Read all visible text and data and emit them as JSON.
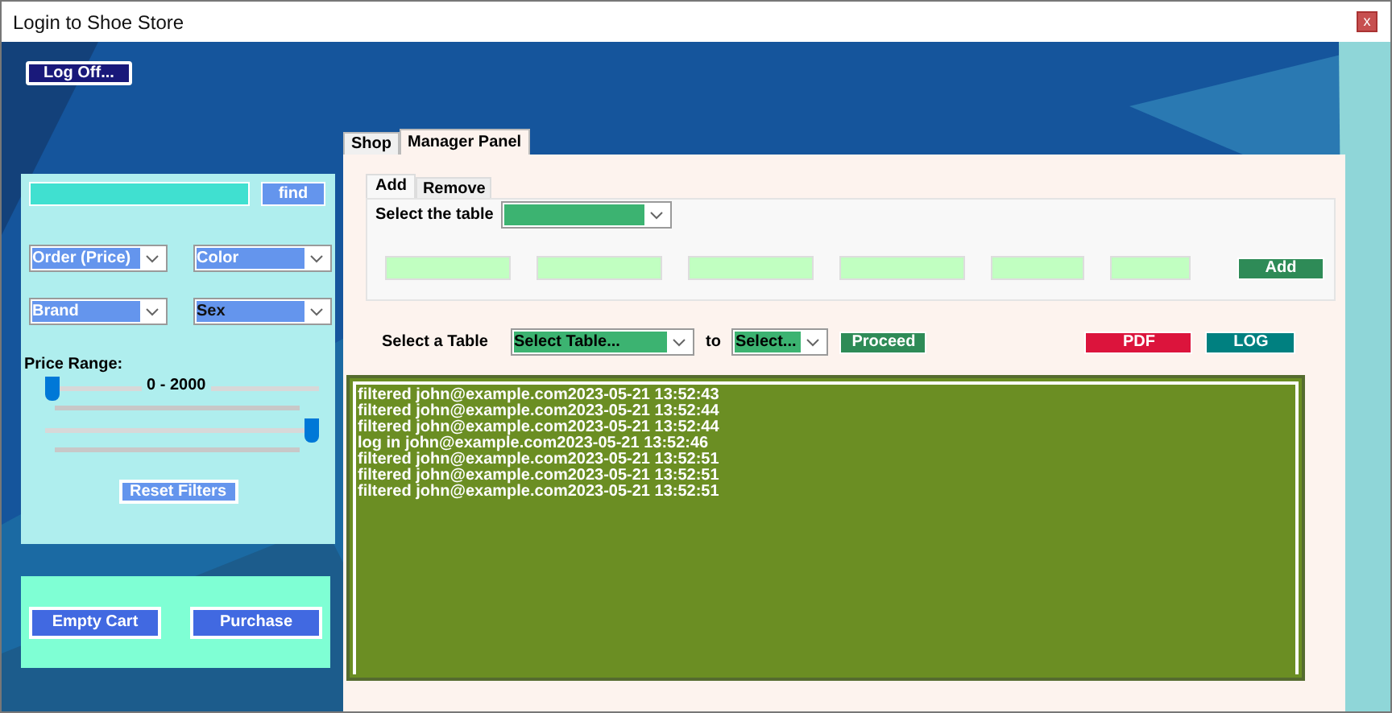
{
  "window": {
    "title": "Login to Shoe Store",
    "close": "x"
  },
  "log_off": "Log Off...",
  "filters": {
    "find": "find",
    "dropdowns": [
      {
        "value": "Order (Price)"
      },
      {
        "value": "Color"
      },
      {
        "value": "Brand"
      },
      {
        "value": "Sex"
      }
    ],
    "price_label": "Price Range:",
    "price_reading": "0 - 2000",
    "sliders": [
      {
        "level": 0
      },
      {
        "level": 1
      }
    ],
    "reset": "Reset Filters"
  },
  "cart": {
    "buttons": [
      "Empty Cart",
      "Purchase"
    ]
  },
  "tabs": [
    {
      "label": "Shop",
      "selected": false
    },
    {
      "label": "Manager Panel",
      "selected": true
    }
  ],
  "subtabs": [
    {
      "label": "Add",
      "selected": true
    },
    {
      "label": "Remove",
      "selected": false
    }
  ],
  "add_panel": {
    "label": "Select the table",
    "button": "Add"
  },
  "transfer": {
    "label": "Select a Table",
    "from": "Select Table...",
    "to_label": "to",
    "to": "Select...",
    "proceed": "Proceed",
    "pdf": "PDF",
    "log": "LOG"
  },
  "log_lines": [
    "filtered john@example.com2023-05-21 13:52:43",
    "filtered john@example.com2023-05-21 13:52:44",
    "filtered john@example.com2023-05-21 13:52:44",
    "log in john@example.com2023-05-21 13:52:46",
    "filtered john@example.com2023-05-21 13:52:51",
    "filtered john@example.com2023-05-21 13:52:51",
    "filtered john@example.com2023-05-21 13:52:51"
  ]
}
